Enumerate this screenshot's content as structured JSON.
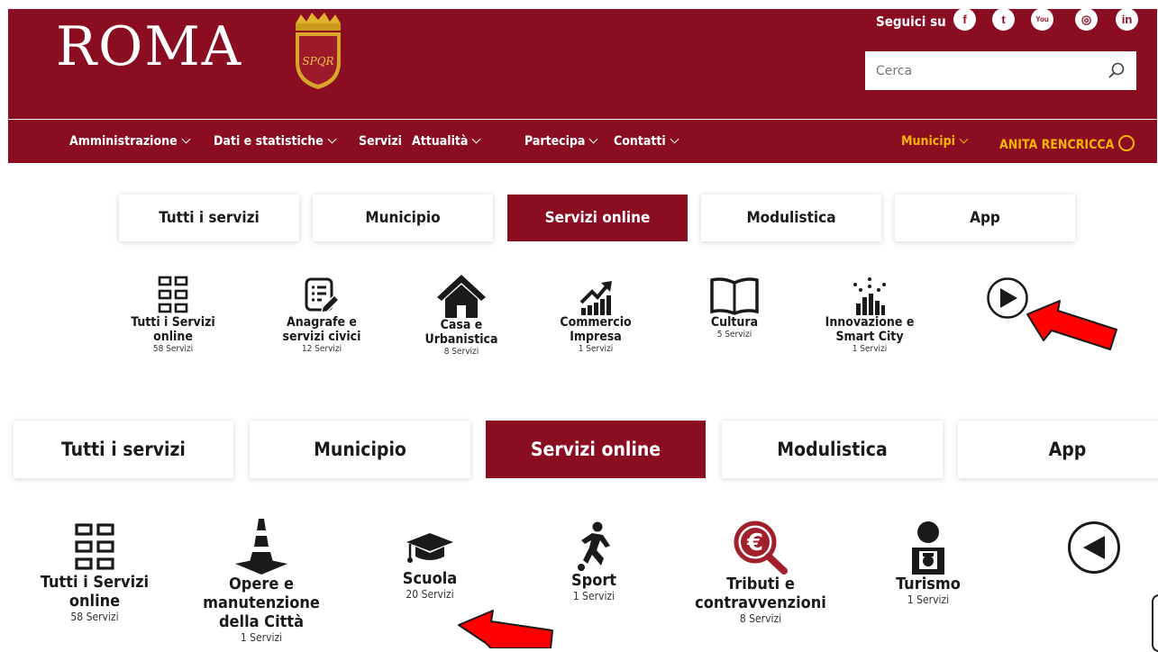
{
  "header": {
    "logo_text": "ROMA",
    "crest_text": "SPQR",
    "follow_label": "Seguici su",
    "social": [
      {
        "icon": "facebook-icon",
        "glyph": "f"
      },
      {
        "icon": "twitter-icon",
        "glyph": "t"
      },
      {
        "icon": "youtube-icon",
        "glyph": "You"
      },
      {
        "icon": "instagram-icon",
        "glyph": "◎"
      },
      {
        "icon": "linkedin-icon",
        "glyph": "in"
      }
    ],
    "search_placeholder": "Cerca"
  },
  "nav": {
    "items": [
      "Amministrazione",
      "Dati e statistiche",
      "Servizi",
      "Attualità",
      "Partecipa",
      "Contatti"
    ],
    "municipi": "Municipi",
    "user": "ANITA RENCRICCA"
  },
  "tabs": [
    "Tutti i servizi",
    "Municipio",
    "Servizi online",
    "Modulistica",
    "App"
  ],
  "active_tab": "Servizi online",
  "row1": [
    {
      "l1": "Tutti i Servizi",
      "l2": "online",
      "count": "58 Servizi",
      "icon": "grid-icon"
    },
    {
      "l1": "Anagrafe e",
      "l2": "servizi civici",
      "count": "12 Servizi",
      "icon": "form-edit-icon"
    },
    {
      "l1": "Casa e",
      "l2": "Urbanistica",
      "count": "8 Servizi",
      "icon": "house-icon"
    },
    {
      "l1": "Commercio",
      "l2": "Impresa",
      "count": "1 Servizi",
      "icon": "chart-growth-icon"
    },
    {
      "l1": "Cultura",
      "l2": "",
      "count": "5 Servizi",
      "icon": "book-icon"
    },
    {
      "l1": "Innovazione e",
      "l2": "Smart City",
      "count": "1 Servizi",
      "icon": "smart-city-icon"
    }
  ],
  "row2": [
    {
      "l1": "Tutti i Servizi",
      "l2": "online",
      "l3": "",
      "count": "58 Servizi",
      "icon": "grid-icon"
    },
    {
      "l1": "Opere e",
      "l2": "manutenzione",
      "l3": "della Città",
      "count": "1 Servizi",
      "icon": "traffic-cone-icon"
    },
    {
      "l1": "Scuola",
      "l2": "",
      "l3": "",
      "count": "20 Servizi",
      "icon": "graduation-cap-icon"
    },
    {
      "l1": "Sport",
      "l2": "",
      "l3": "",
      "count": "1 Servizi",
      "icon": "soccer-player-icon"
    },
    {
      "l1": "Tributi e",
      "l2": "contravvenzioni",
      "l3": "",
      "count": "8 Servizi",
      "icon": "euro-search-icon"
    },
    {
      "l1": "Turismo",
      "l2": "",
      "l3": "",
      "count": "1 Servizi",
      "icon": "tourist-icon"
    }
  ],
  "colors": {
    "brand": "#8b0d22",
    "accent": "#f7b500",
    "annotation_arrow": "#ff0000"
  }
}
